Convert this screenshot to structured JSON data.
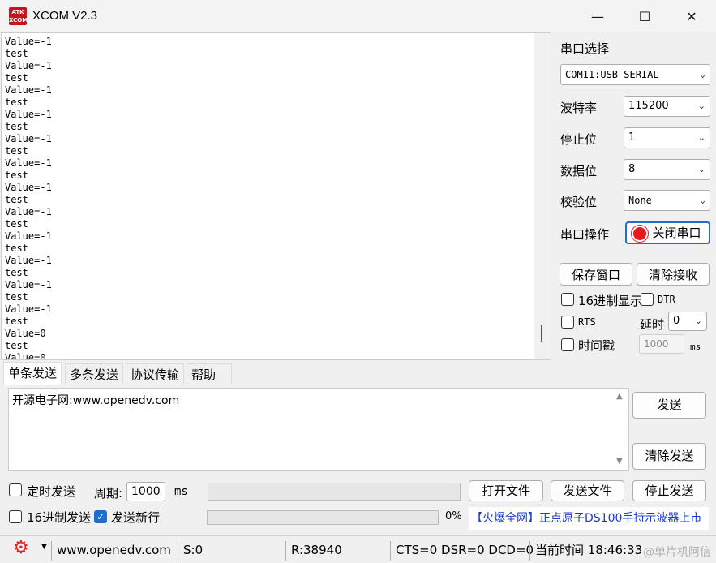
{
  "window": {
    "title": "XCOM V2.3",
    "logo_text_top": "ATK",
    "logo_text_bottom": "XCOM",
    "minimize_glyph": "—",
    "maximize_glyph": "☐",
    "close_glyph": "✕"
  },
  "receive": {
    "lines": "Value=-1\ntest\nValue=-1\ntest\nValue=-1\ntest\nValue=-1\ntest\nValue=-1\ntest\nValue=-1\ntest\nValue=-1\ntest\nValue=-1\ntest\nValue=-1\ntest\nValue=-1\ntest\nValue=-1\ntest\nValue=-1\ntest\nValue=0\ntest\nValue=0\nte"
  },
  "serial": {
    "section_title": "串口选择",
    "port_value": "COM11:USB-SERIAL",
    "baud_label": "波特率",
    "baud_value": "115200",
    "stop_label": "停止位",
    "stop_value": "1",
    "data_label": "数据位",
    "data_value": "8",
    "parity_label": "校验位",
    "parity_value": "None",
    "op_label": "串口操作",
    "op_button": "关闭串口",
    "save_window": "保存窗口",
    "clear_receive": "清除接收",
    "hex_display": "16进制显示",
    "dtr": "DTR",
    "rts": "RTS",
    "delay_label": "延时",
    "delay_value": "0",
    "timestamp": "时间戳",
    "timestamp_value": "1000",
    "ms": "ms"
  },
  "tabs": [
    "单条发送",
    "多条发送",
    "协议传输",
    "帮助"
  ],
  "send": {
    "text": "开源电子网:www.openedv.com",
    "send_button": "发送",
    "clear_send": "清除发送",
    "timed_send": "定时发送",
    "period_label": "周期:",
    "period_value": "1000",
    "period_unit": "ms",
    "open_file": "打开文件",
    "send_file": "发送文件",
    "stop_send": "停止发送",
    "hex_send": "16进制发送",
    "send_newline": "发送新行",
    "progress_percent": "0%",
    "ad_text": "【火爆全网】正点原子DS100手持示波器上市"
  },
  "status": {
    "website": "www.openedv.com",
    "sent": "S:0",
    "received": "R:38940",
    "lines": "CTS=0 DSR=0 DCD=0",
    "time": "当前时间 18:46:33"
  },
  "watermark": "@单片机阿信",
  "colors": {
    "accent": "#1a6fd1",
    "ad_blue": "#1a3ccf",
    "logo_red": "#c4161c",
    "gear_red": "#d9261c"
  }
}
